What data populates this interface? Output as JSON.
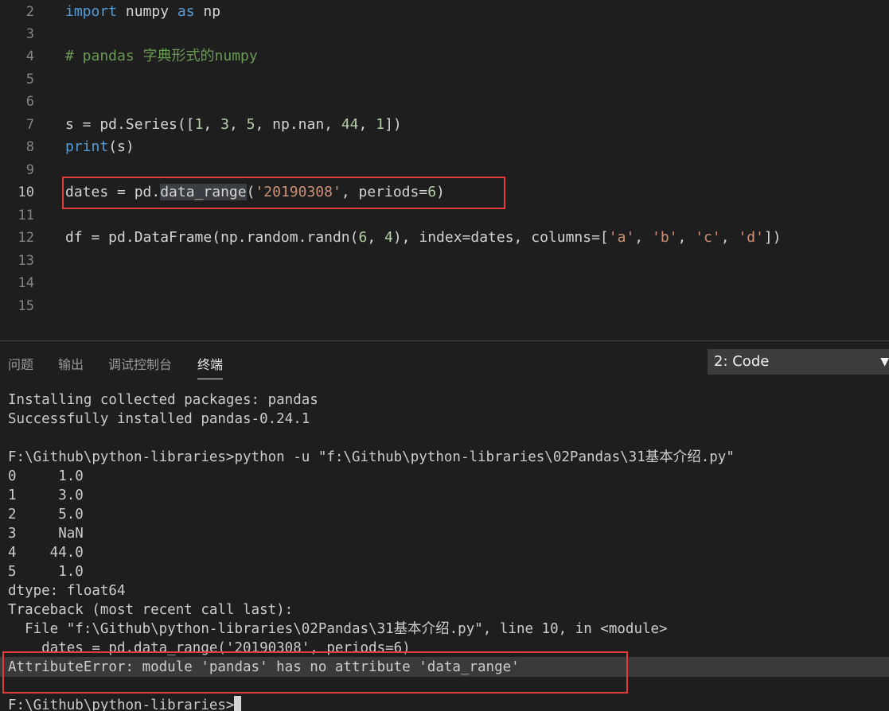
{
  "editor": {
    "lines": [
      {
        "num": "2",
        "code": ""
      },
      {
        "num": "3",
        "code": ""
      },
      {
        "num": "4",
        "code": ""
      },
      {
        "num": "5",
        "code": ""
      },
      {
        "num": "6",
        "code": ""
      },
      {
        "num": "7",
        "code": ""
      },
      {
        "num": "8",
        "code": ""
      },
      {
        "num": "9",
        "code": ""
      },
      {
        "num": "10",
        "code": ""
      },
      {
        "num": "11",
        "code": ""
      },
      {
        "num": "12",
        "code": ""
      },
      {
        "num": "13",
        "code": ""
      },
      {
        "num": "14",
        "code": ""
      },
      {
        "num": "15",
        "code": ""
      }
    ],
    "active_line": "10",
    "tokens": {
      "l2_import": "import",
      "l2_mid": " numpy ",
      "l2_as": "as",
      "l2_end": " np",
      "l4_comment": "# pandas 字典形式的numpy",
      "l7_a": "s = pd.Series([",
      "l7_n1": "1",
      "l7_c1": ", ",
      "l7_n2": "3",
      "l7_c2": ", ",
      "l7_n3": "5",
      "l7_c3": ", np.nan, ",
      "l7_n4": "44",
      "l7_c4": ", ",
      "l7_n5": "1",
      "l7_end": "])",
      "l8_print": "print",
      "l8_rest": "(s)",
      "l10_a": "dates = pd.",
      "l10_fn": "data_range",
      "l10_b": "(",
      "l10_str": "'20190308'",
      "l10_c": ", periods=",
      "l10_num": "6",
      "l10_end": ")",
      "l12_a": "df = pd.DataFrame(np.random.randn(",
      "l12_n1": "6",
      "l12_c1": ", ",
      "l12_n2": "4",
      "l12_b": "), index=dates, columns=[",
      "l12_s1": "'a'",
      "l12_c2": ", ",
      "l12_s2": "'b'",
      "l12_c3": ", ",
      "l12_s3": "'c'",
      "l12_c4": ", ",
      "l12_s4": "'d'",
      "l12_end": "])"
    }
  },
  "panel": {
    "tabs": [
      {
        "label": "问题"
      },
      {
        "label": "输出"
      },
      {
        "label": "调试控制台"
      },
      {
        "label": "终端"
      }
    ],
    "active_tab": "终端",
    "terminal_selector": "2: Code",
    "terminal_selector_arrow": "▼"
  },
  "terminal": {
    "lines": [
      "Installing collected packages: pandas",
      "Successfully installed pandas-0.24.1",
      "",
      "F:\\Github\\python-libraries>python -u \"f:\\Github\\python-libraries\\02Pandas\\31基本介绍.py\"",
      "0     1.0",
      "1     3.0",
      "2     5.0",
      "3     NaN",
      "4    44.0",
      "5     1.0",
      "dtype: float64",
      "Traceback (most recent call last):",
      "  File \"f:\\Github\\python-libraries\\02Pandas\\31基本介绍.py\", line 10, in <module>",
      "    dates = pd.data_range('20190308', periods=6)",
      "AttributeError: module 'pandas' has no attribute 'data_range'",
      "",
      "F:\\Github\\python-libraries>"
    ]
  },
  "colors": {
    "background": "#1e1e1e",
    "keyword": "#569cd6",
    "comment": "#6a9955",
    "string": "#ce9178",
    "number": "#b5cea8",
    "highlight_box": "#e03c3c"
  }
}
